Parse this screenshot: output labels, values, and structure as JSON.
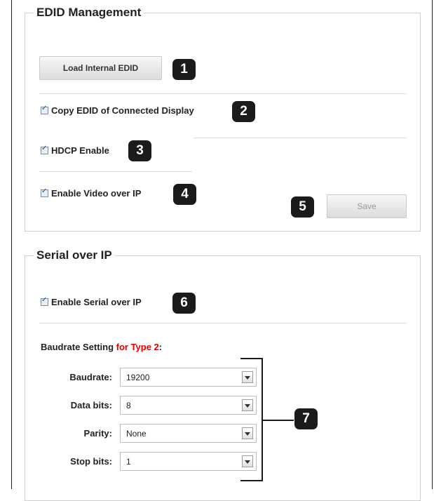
{
  "edid": {
    "title": "EDID Management",
    "load_button": "Load Internal EDID",
    "copy_edid_label": "Copy EDID of Connected Display",
    "hdcp_label": "HDCP Enable",
    "video_over_ip_label": "Enable Video over IP",
    "save_button": "Save"
  },
  "serial": {
    "title": "Serial over IP",
    "enable_label": "Enable Serial over IP",
    "baud_heading": "Baudrate Setting ",
    "baud_heading_red": "for Type 2",
    "baud_heading_colon": ":",
    "fields": [
      {
        "label": "Baudrate:",
        "value": "19200"
      },
      {
        "label": "Data bits:",
        "value": "8"
      },
      {
        "label": "Parity:",
        "value": "None"
      },
      {
        "label": "Stop bits:",
        "value": "1"
      }
    ]
  },
  "callouts": [
    "1",
    "2",
    "3",
    "4",
    "5",
    "6",
    "7"
  ],
  "colors": {
    "badge": "#1b1b1b",
    "accent_red": "#e00000"
  }
}
